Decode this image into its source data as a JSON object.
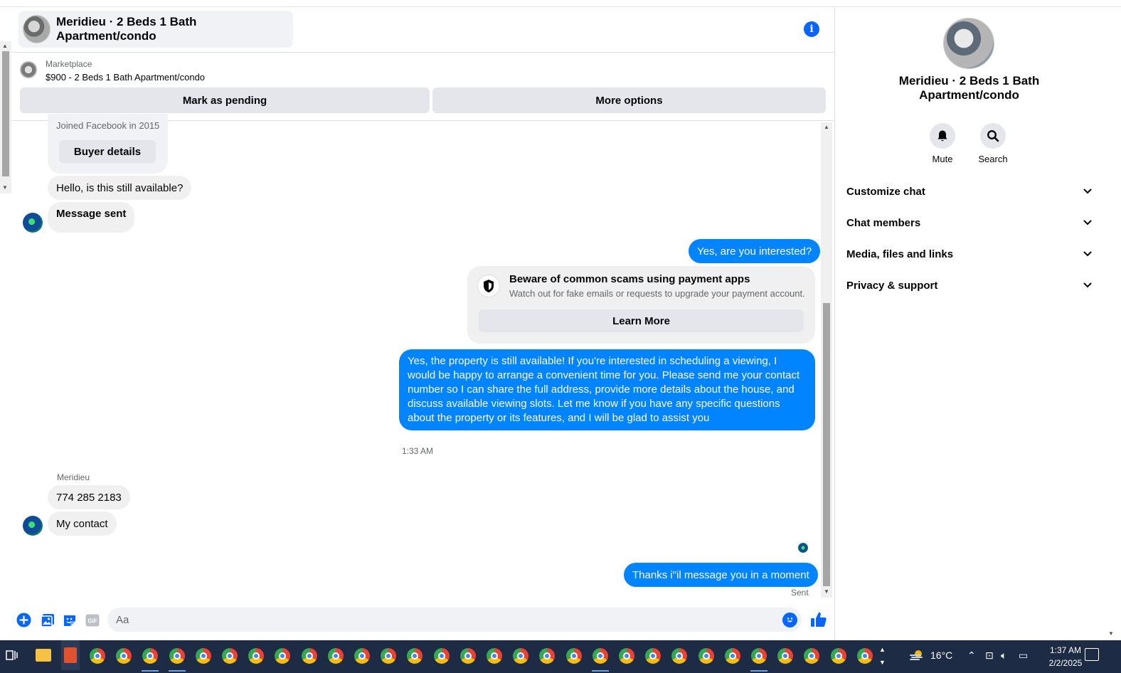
{
  "chat": {
    "title": "Meridieu · 2 Beds 1 Bath Apartment/condo",
    "marketplace_label": "Marketplace",
    "listing": "$900 - 2 Beds 1 Bath Apartment/condo",
    "mark_pending": "Mark as pending",
    "more_options": "More options"
  },
  "intro": {
    "joined": "Joined Facebook in 2015",
    "buyer_details": "Buyer details"
  },
  "messages": {
    "m1": "Hello, is this still available?",
    "m2": "Message sent",
    "m3": "Yes, are you interested?",
    "scam_title": "Beware of common scams using payment apps",
    "scam_sub": "Watch out for fake emails or requests to upgrade your payment account.",
    "learn_more": "Learn More",
    "m4": "Yes, the property is still available! If you're interested in scheduling a viewing, I would be happy to arrange a convenient time for you. Please send me your contact number so I can share the full address, provide more details about the house, and discuss available viewing slots. Let me know if you have any specific questions about the property or its features, and I will be glad to assist you",
    "time": "1:33 AM",
    "sender": "Meridieu",
    "m5": "774 285 2183",
    "m6": "My contact",
    "m7": "Thanks i\"il message you in a moment",
    "sent": "Sent"
  },
  "composer": {
    "placeholder": "Aa",
    "gif": "GIF"
  },
  "right_panel": {
    "name": "Meridieu · 2 Beds 1 Bath Apartment/condo",
    "mute": "Mute",
    "search": "Search",
    "menu": [
      "Customize chat",
      "Chat members",
      "Media, files and links",
      "Privacy & support"
    ]
  },
  "taskbar": {
    "temperature": "16°C",
    "time": "1:37 AM",
    "date": "2/2/2025"
  },
  "colors": {
    "accent": "#0084ff",
    "bubble_in": "#f0f0f0",
    "button_gray": "#e4e6eb",
    "taskbar": "#1d2b45"
  },
  "icons": [
    "info-icon",
    "shield-icon",
    "plus-icon",
    "image-icon",
    "sticker-icon",
    "gif-icon",
    "emoji-icon",
    "like-icon",
    "bell-icon",
    "search-icon",
    "chevron-down-icon",
    "chrome-icon",
    "folder-icon"
  ]
}
